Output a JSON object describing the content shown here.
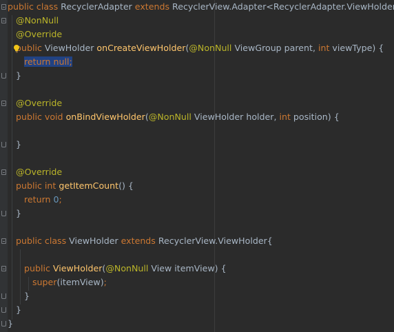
{
  "code": {
    "l1": {
      "a": "public class ",
      "b": "RecyclerAdapter ",
      "c": "extends ",
      "d": "RecyclerView.Adapter<RecyclerAdapter.ViewHolder>{"
    },
    "l2": {
      "a": "@NonNull"
    },
    "l3": {
      "a": "@Override"
    },
    "l4": {
      "a": "public ",
      "b": "ViewHolder ",
      "c": "onCreateViewHolder",
      "d": "(",
      "e": "@NonNull ",
      "f": "ViewGroup parent, ",
      "g": "int ",
      "h": "viewType) {"
    },
    "l5": {
      "a": "return null",
      "b": ";"
    },
    "l6": {
      "a": "}"
    },
    "l8": {
      "a": "@Override"
    },
    "l9": {
      "a": "public void ",
      "b": "onBindViewHolder",
      "c": "(",
      "d": "@NonNull ",
      "e": "ViewHolder holder, ",
      "f": "int ",
      "g": "position) {"
    },
    "l11": {
      "a": "}"
    },
    "l13": {
      "a": "@Override"
    },
    "l14": {
      "a": "public int ",
      "b": "getItemCount",
      "c": "() {"
    },
    "l15": {
      "a": "return ",
      "b": "0",
      "c": ";"
    },
    "l16": {
      "a": "}"
    },
    "l18": {
      "a": "public class ",
      "b": "ViewHolder ",
      "c": "extends ",
      "d": "RecyclerView.ViewHolder{"
    },
    "l20": {
      "a": "public ",
      "b": "ViewHolder",
      "c": "(",
      "d": "@NonNull ",
      "e": "View itemView) {"
    },
    "l21": {
      "a": "super",
      "b": "(itemView)",
      "c": ";"
    },
    "l22": {
      "a": "}"
    },
    "l23": {
      "a": "}"
    },
    "l24": {
      "a": "}"
    }
  },
  "colors": {
    "background": "#2b2b2b",
    "keyword": "#cc7832",
    "annotation": "#bbb529",
    "method": "#ffc66d",
    "number": "#6897bb",
    "text": "#a9b7c6",
    "selection": "#214283"
  },
  "icons": {
    "intention": "lightbulb-icon",
    "fold": "fold-marker-icon"
  }
}
